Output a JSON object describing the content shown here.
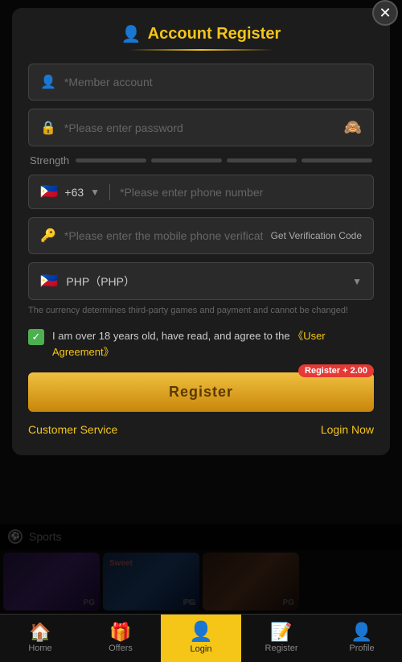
{
  "modal": {
    "title": "Account Register",
    "title_icon": "👤",
    "close_icon": "✕"
  },
  "form": {
    "member_account_placeholder": "*Member account",
    "password_placeholder": "*Please enter password",
    "strength_label": "Strength",
    "strength_bars": 4,
    "country_flag": "🇵🇭",
    "country_code": "+63",
    "phone_placeholder": "*Please enter phone number",
    "verification_placeholder": "*Please enter the mobile phone verification code",
    "get_code_label": "Get Verification Code",
    "currency_flag": "🇵🇭",
    "currency_text": "PHP（PHP）",
    "currency_note": "The currency determines third-party games and payment and cannot be changed!",
    "checkbox_text": "I am over 18 years old, have read, and agree to the ",
    "agreement_link": "《User Agreement》",
    "register_badge": "Register + 2.00",
    "register_button": "Register",
    "customer_service": "Customer Service",
    "login_now": "Login Now"
  },
  "sports_bar": {
    "label": "Sports"
  },
  "bottom_nav": {
    "items": [
      {
        "id": "home",
        "label": "Home",
        "icon": "🏠",
        "active": false
      },
      {
        "id": "offers",
        "label": "Offers",
        "icon": "🎁",
        "active": false
      },
      {
        "id": "login",
        "label": "Login",
        "icon": "👤",
        "active": true
      },
      {
        "id": "register",
        "label": "Register",
        "icon": "📝",
        "active": false
      },
      {
        "id": "profile",
        "label": "Profile",
        "icon": "👤",
        "active": false
      }
    ]
  }
}
